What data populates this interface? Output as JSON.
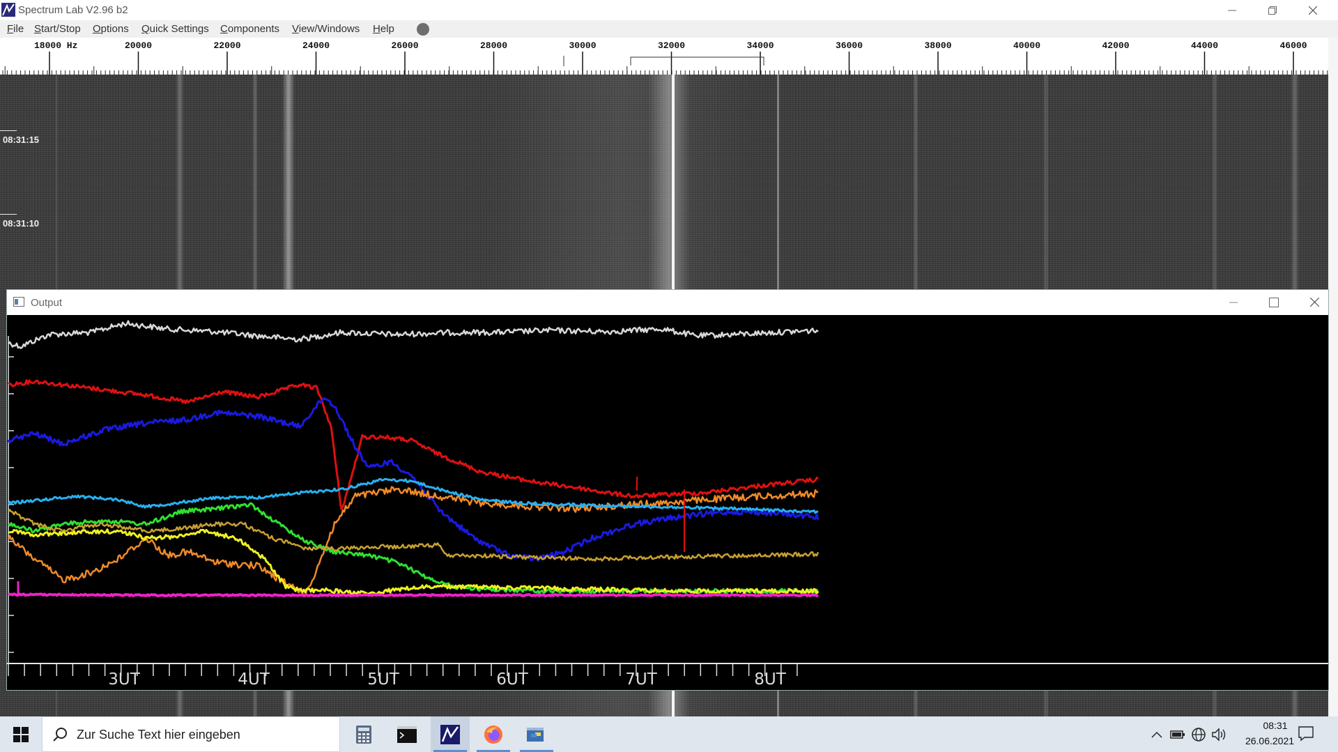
{
  "app": {
    "title": "Spectrum Lab V2.96 b2",
    "menu": [
      "File",
      "Start/Stop",
      "Options",
      "Quick Settings",
      "Components",
      "View/Windows",
      "Help"
    ]
  },
  "freq_scale": {
    "labels": [
      "18000 Hz",
      "20000",
      "22000",
      "24000",
      "26000",
      "28000",
      "30000",
      "32000",
      "34000",
      "36000",
      "38000",
      "40000",
      "42000",
      "44000",
      "46000"
    ]
  },
  "waterfall": {
    "time_labels": [
      "08:31:15",
      "08:31:10"
    ]
  },
  "output_window": {
    "title": "Output",
    "x_labels": [
      "3UT",
      "4UT",
      "5UT",
      "6UT",
      "7UT",
      "8UT"
    ],
    "trace_colors": [
      "#d8d8d8",
      "#e01010",
      "#1a1ae0",
      "#f08a28",
      "#28b0f0",
      "#30e030",
      "#f0f020",
      "#c8a030",
      "#f020c8"
    ]
  },
  "taskbar": {
    "search_placeholder": "Zur Suche Text hier eingeben",
    "apps": [
      "calculator-icon",
      "terminal-icon",
      "spectrum-lab-icon",
      "firefox-icon",
      "python-icon"
    ],
    "clock_time": "08:31",
    "clock_date": "26.06.2021"
  }
}
